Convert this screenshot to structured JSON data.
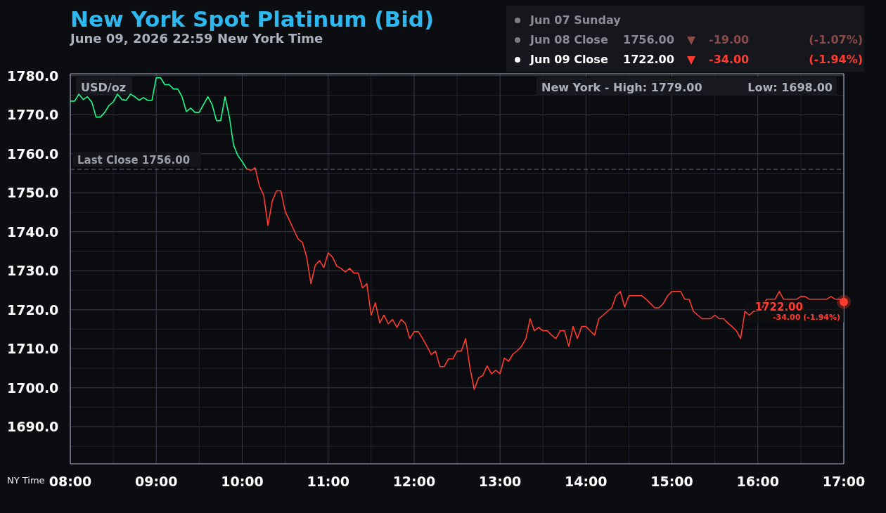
{
  "header": {
    "title": "New York Spot Platinum (Bid)",
    "subtitle": "June 09, 2026 22:59 New York Time"
  },
  "legend": {
    "rows": [
      {
        "date": "Jun 07 Sunday",
        "current": false
      },
      {
        "date": "Jun 08 Close",
        "price": "1756.00",
        "falling": true,
        "change": "-19.00",
        "percent": "(-1.07%)",
        "current": false
      },
      {
        "date": "Jun 09 Close",
        "price": "1722.00",
        "falling": true,
        "change": "-34.00",
        "percent": "(-1.94%)",
        "current": true
      }
    ]
  },
  "chart": {
    "range_labels": [
      "New York - High: 1779.00",
      "Low: 1698.00"
    ],
    "chart_data": {
      "type": "line",
      "xlabel": "NY Time",
      "ylabel": "USD/oz",
      "grid": true,
      "xlim": [
        8,
        17
      ],
      "ylim": [
        1680.5,
        1780.5
      ],
      "x": [
        8,
        8.05,
        8.1,
        8.15,
        8.2,
        8.25,
        8.3,
        8.35,
        8.4,
        8.45,
        8.5,
        8.55,
        8.6,
        8.65,
        8.7,
        8.75,
        8.8,
        8.85,
        8.9,
        8.95,
        9,
        9.05,
        9.1,
        9.15,
        9.2,
        9.25,
        9.3,
        9.35,
        9.4,
        9.45,
        9.5,
        9.55,
        9.6,
        9.65,
        9.7,
        9.75,
        9.8,
        9.85,
        9.9,
        9.95,
        10,
        10.05,
        10.1,
        10.15,
        10.2,
        10.25,
        10.3,
        10.35,
        10.4,
        10.45,
        10.5,
        10.55,
        10.6,
        10.65,
        10.7,
        10.75,
        10.8,
        10.85,
        10.9,
        10.95,
        11,
        11.05,
        11.1,
        11.15,
        11.2,
        11.25,
        11.3,
        11.35,
        11.4,
        11.45,
        11.5,
        11.55,
        11.6,
        11.65,
        11.7,
        11.75,
        11.8,
        11.85,
        11.9,
        11.95,
        12,
        12.05,
        12.1,
        12.15,
        12.2,
        12.25,
        12.3,
        12.35,
        12.4,
        12.45,
        12.5,
        12.55,
        12.6,
        12.65,
        12.7,
        12.75,
        12.8,
        12.85,
        12.9,
        12.95,
        13,
        13.05,
        13.1,
        13.15,
        13.2,
        13.25,
        13.3,
        13.35,
        13.4,
        13.45,
        13.5,
        13.55,
        13.6,
        13.65,
        13.7,
        13.75,
        13.8,
        13.85,
        13.9,
        13.95,
        14,
        14.05,
        14.1,
        14.15,
        14.2,
        14.25,
        14.3,
        14.35,
        14.4,
        14.45,
        14.5,
        14.55,
        14.6,
        14.65,
        14.7,
        14.75,
        14.8,
        14.85,
        14.9,
        14.95,
        15,
        15.05,
        15.1,
        15.15,
        15.2,
        15.25,
        15.3,
        15.35,
        15.4,
        15.45,
        15.5,
        15.55,
        15.6,
        15.65,
        15.7,
        15.75,
        15.8,
        15.85,
        15.9,
        15.95,
        16,
        16.05,
        16.1,
        16.15,
        16.2,
        16.25,
        16.3,
        16.35,
        16.4,
        16.45,
        16.5,
        16.55,
        16.6,
        16.65,
        16.7,
        16.75,
        16.8,
        16.85,
        16.9,
        16.95,
        17
      ],
      "xticks": [
        {
          "value": 8,
          "label": "08:00"
        },
        {
          "value": 9,
          "label": "09:00"
        },
        {
          "value": 10,
          "label": "10:00"
        },
        {
          "value": 11,
          "label": "11:00"
        },
        {
          "value": 12,
          "label": "12:00"
        },
        {
          "value": 13,
          "label": "13:00"
        },
        {
          "value": 14,
          "label": "14:00"
        },
        {
          "value": 15,
          "label": "15:00"
        },
        {
          "value": 16,
          "label": "16:00"
        },
        {
          "value": 17,
          "label": "17:00"
        }
      ],
      "yticks": [
        {
          "value": 1780,
          "label": "1780.0"
        },
        {
          "value": 1770,
          "label": "1770.0"
        },
        {
          "value": 1760,
          "label": "1760.0"
        },
        {
          "value": 1750,
          "label": "1750.0"
        },
        {
          "value": 1740,
          "label": "1740.0"
        },
        {
          "value": 1730,
          "label": "1730.0"
        },
        {
          "value": 1720,
          "label": "1720.0"
        },
        {
          "value": 1710,
          "label": "1710.0"
        },
        {
          "value": 1700,
          "label": "1700.0"
        },
        {
          "value": 1690,
          "label": "1690.0"
        }
      ],
      "series": [
        {
          "color": "#1aff8c",
          "values": [
            1773.5,
            1773.5,
            1775.3,
            1773.9,
            1774.6,
            1773.2,
            1769.4,
            1769.4,
            1770.6,
            1772.4,
            1773.3,
            1775.3,
            1773.9,
            1773.7,
            1775.3,
            1774.6,
            1773.7,
            1774.4,
            1773.7,
            1773.7,
            1779.5,
            1779.5,
            1777.7,
            1777.7,
            1776.6,
            1776.6,
            1774.6,
            1770.8,
            1771.7,
            1770.6,
            1770.6,
            1772.6,
            1774.6,
            1772.6,
            1768.5,
            1768.5,
            1774.6,
            1769.5,
            1762.2,
            1759.5,
            1758.0,
            1756.2,
            null,
            null,
            null,
            null,
            null,
            null,
            null,
            null,
            null,
            null,
            null,
            null,
            null,
            null,
            null,
            null,
            null,
            null,
            null,
            null,
            null,
            null,
            null,
            null,
            null,
            null,
            null,
            null,
            null,
            null,
            null,
            null,
            null,
            null,
            null,
            null,
            null,
            null,
            null,
            null,
            null,
            null,
            null,
            null,
            null,
            null,
            null,
            null,
            null,
            null,
            null,
            null,
            null,
            null,
            null,
            null,
            null,
            null,
            null,
            null,
            null,
            null,
            null,
            null,
            null,
            null,
            null,
            null,
            null,
            null,
            null,
            null,
            null,
            null,
            null,
            null,
            null,
            null,
            null,
            null,
            null,
            null,
            null,
            null,
            null,
            null,
            null,
            null,
            null,
            null,
            null,
            null,
            null,
            null,
            null,
            null,
            null,
            null,
            null,
            null,
            null,
            null,
            null,
            null,
            null,
            null,
            null,
            null,
            null,
            null,
            null,
            null,
            null,
            null,
            null,
            null,
            null,
            null,
            null,
            null,
            null,
            null,
            null,
            null,
            null,
            null,
            null,
            null,
            null,
            null,
            null,
            null,
            null,
            null,
            null,
            null,
            null,
            null,
            null
          ]
        },
        {
          "color": "#ff3b30",
          "values": [
            null,
            null,
            null,
            null,
            null,
            null,
            null,
            null,
            null,
            null,
            null,
            null,
            null,
            null,
            null,
            null,
            null,
            null,
            null,
            null,
            null,
            null,
            null,
            null,
            null,
            null,
            null,
            null,
            null,
            null,
            null,
            null,
            null,
            null,
            null,
            null,
            null,
            null,
            null,
            null,
            null,
            1756.2,
            1755.7,
            1756.4,
            1751.7,
            1749.4,
            1741.6,
            1747.9,
            1750.5,
            1750.5,
            1745.2,
            1742.9,
            1740.5,
            1738.2,
            1737.3,
            1733.5,
            1726.7,
            1731.4,
            1732.6,
            1730.8,
            1734.6,
            1733.5,
            1731.2,
            1730.6,
            1729.7,
            1730.6,
            1729.4,
            1729.4,
            1725.6,
            1726.7,
            1718.6,
            1721.8,
            1716.6,
            1718.6,
            1716.4,
            1717.5,
            1715.5,
            1717.5,
            1716.4,
            1712.6,
            1714.4,
            1714.4,
            1712.6,
            1710.6,
            1708.5,
            1709.4,
            1705.4,
            1705.4,
            1707.4,
            1707.4,
            1709.4,
            1709.4,
            1712.6,
            1705.2,
            1699.6,
            1702.5,
            1703.2,
            1705.6,
            1703.6,
            1704.5,
            1703.6,
            1707.6,
            1706.8,
            1708.6,
            1709.5,
            1710.6,
            1712.6,
            1717.7,
            1714.6,
            1715.5,
            1714.6,
            1714.6,
            1713.5,
            1712.6,
            1714.6,
            1714.6,
            1710.6,
            1715.7,
            1712.6,
            1715.7,
            1715.7,
            1714.6,
            1713.5,
            1717.7,
            1718.6,
            1719.6,
            1720.5,
            1723.6,
            1724.7,
            1720.7,
            1723.6,
            1723.6,
            1723.6,
            1723.6,
            1722.7,
            1721.6,
            1720.5,
            1720.5,
            1721.6,
            1723.6,
            1724.7,
            1724.7,
            1724.7,
            1722.7,
            1722.7,
            1719.6,
            1718.6,
            1717.7,
            1717.7,
            1717.7,
            1718.6,
            1717.7,
            1717.7,
            1716.6,
            1715.7,
            1714.6,
            1712.6,
            1719.6,
            1718.6,
            1719.6,
            1719.6,
            1720.5,
            1722.7,
            1722.7,
            1722.7,
            1724.7,
            1722.7,
            1722.7,
            1722.7,
            1722.7,
            1723.4,
            1723.4,
            1722.7,
            1722.7,
            1722.7,
            1722.7,
            1722.7,
            1723.4,
            1722.7,
            1722.7,
            1722.0
          ]
        }
      ],
      "ref_lines": [
        {
          "axis": "y",
          "value": 1756,
          "label": "Last Close 1756.00"
        }
      ],
      "annotations": [
        "1722.00",
        "-34.00 (-1.94%)"
      ]
    }
  }
}
